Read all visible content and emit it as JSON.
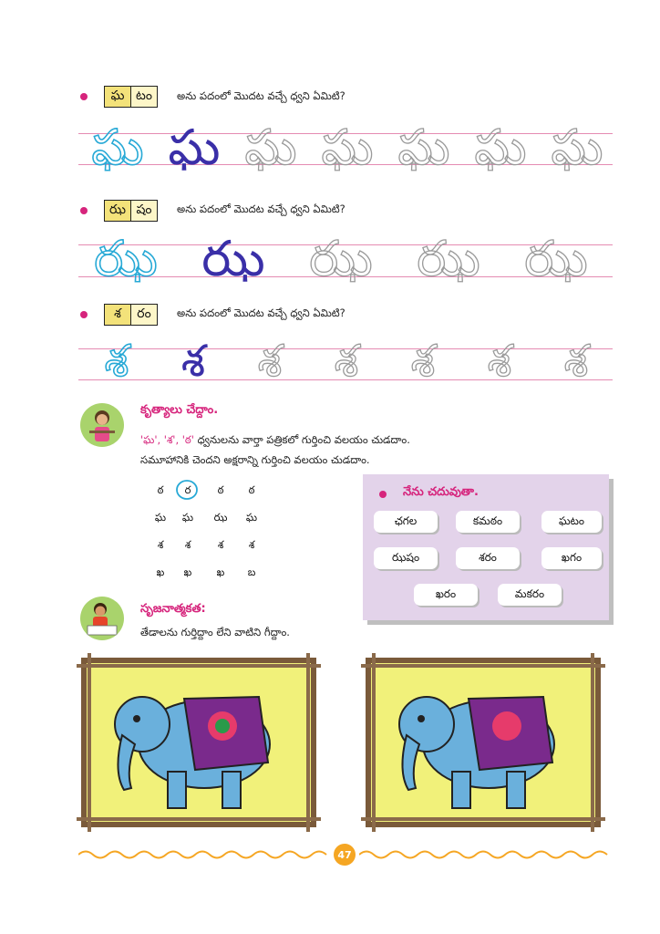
{
  "sections": [
    {
      "tiles": [
        "ఘ",
        "టం"
      ],
      "question": "అను పదంలో మొదట వచ్చే ధ్వని ఏమిటి?",
      "letter": "ఘ"
    },
    {
      "tiles": [
        "ఝ",
        "షం"
      ],
      "question": "అను పదంలో మొదట వచ్చే ధ్వని ఏమిటి?",
      "letter": "ఝ"
    },
    {
      "tiles": [
        "శ",
        "రం"
      ],
      "question": "అను పదంలో మొదట వచ్చే ధ్వని ఏమిటి?",
      "letter": "శ"
    }
  ],
  "activity": {
    "title": "కృత్యాలు చేద్దాం.",
    "line1_letters": "'ఘ', 'శ', 'ఠ'",
    "line1_rest": "ధ్వనులను వార్తా పత్రికలో గుర్తించి వలయం చుడదాం.",
    "line2": "సమూహానికి చెందని అక్షరాన్ని గుర్తించి వలయం చుడదాం.",
    "grid": [
      [
        "ఠ",
        "ర",
        "ఠ",
        "ఠ"
      ],
      [
        "ఘ",
        "ఘ",
        "ఝ",
        "ఘ"
      ],
      [
        "శ",
        "శ",
        "శ",
        "శ"
      ],
      [
        "ఖ",
        "ఖ",
        "ఖ",
        "బ"
      ]
    ]
  },
  "reading": {
    "title": "నేను చదువుతా.",
    "words": [
      "ఛగల",
      "కమఠం",
      "ఘటం",
      "ఝషం",
      "శరం",
      "ఖగం",
      "ఖరం",
      "మకరం"
    ]
  },
  "creative": {
    "title": "సృజనాత్మకత:",
    "instruction": "తేడాలను గుర్తిద్దాం లేని వాటిని గీద్దాం."
  },
  "page_number": "47"
}
